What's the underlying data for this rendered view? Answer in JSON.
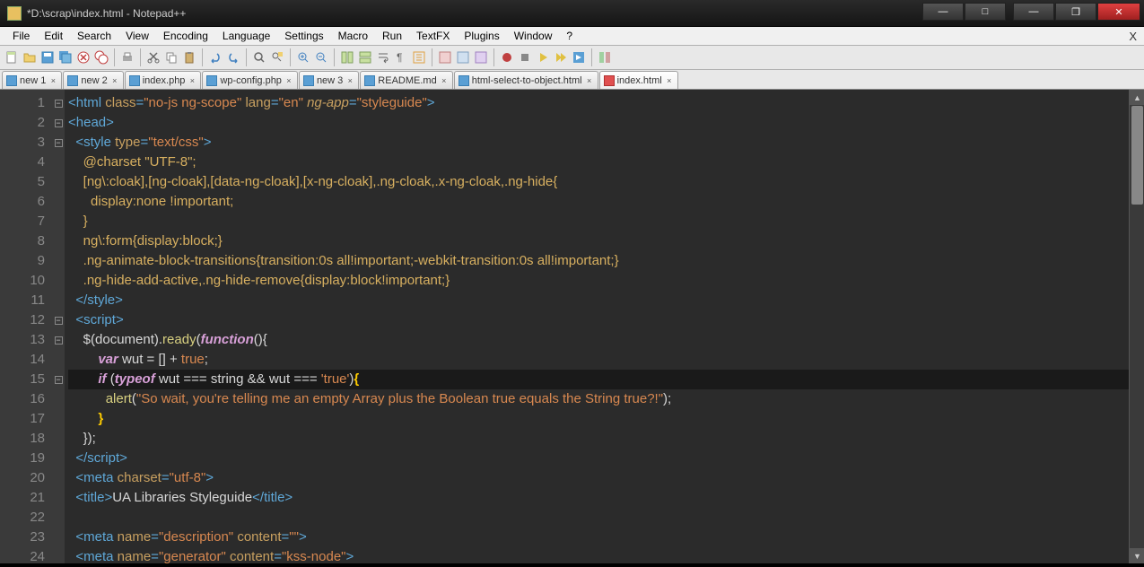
{
  "title": "*D:\\scrap\\index.html - Notepad++",
  "menu": [
    "File",
    "Edit",
    "Search",
    "View",
    "Encoding",
    "Language",
    "Settings",
    "Macro",
    "Run",
    "TextFX",
    "Plugins",
    "Window",
    "?"
  ],
  "tabs": [
    {
      "label": "new  1",
      "unsaved": false,
      "active": false
    },
    {
      "label": "new  2",
      "unsaved": false,
      "active": false
    },
    {
      "label": "index.php",
      "unsaved": false,
      "active": false
    },
    {
      "label": "wp-config.php",
      "unsaved": false,
      "active": false
    },
    {
      "label": "new  3",
      "unsaved": false,
      "active": false
    },
    {
      "label": "README.md",
      "unsaved": false,
      "active": false
    },
    {
      "label": "html-select-to-object.html",
      "unsaved": false,
      "active": false
    },
    {
      "label": "index.html",
      "unsaved": true,
      "active": true
    }
  ],
  "lines_start": 1,
  "lines_end": 24,
  "highlighted_line": 15,
  "fold_markers": {
    "1": "-",
    "2": "-",
    "3": "-",
    "12": "-",
    "13": "-",
    "15": "-"
  },
  "code": {
    "l1": {
      "pre": "<",
      "tag": "html",
      "sp": " ",
      "a1": "class",
      "eq1": "=",
      "v1": "\"no-js ng-scope\"",
      "sp2": " ",
      "a2": "lang",
      "eq2": "=",
      "v2": "\"en\"",
      "sp3": " ",
      "a3": "ng-app",
      "eq3": "=",
      "v3": "\"styleguide\"",
      "post": ">"
    },
    "l2": {
      "pre": "<",
      "tag": "head",
      "post": ">"
    },
    "l3": {
      "indent": "  ",
      "pre": "<",
      "tag": "style",
      "sp": " ",
      "a1": "type",
      "eq": "=",
      "v1": "\"text/css\"",
      "post": ">"
    },
    "l4": {
      "indent": "    ",
      "text": "@charset \"UTF-8\";"
    },
    "l5": {
      "indent": "    ",
      "text": "[ng\\:cloak],[ng-cloak],[data-ng-cloak],[x-ng-cloak],.ng-cloak,.x-ng-cloak,.ng-hide{"
    },
    "l6": {
      "indent": "      ",
      "text": "display:none !important;"
    },
    "l7": {
      "indent": "    ",
      "text": "}"
    },
    "l8": {
      "indent": "    ",
      "text": "ng\\:form{display:block;}"
    },
    "l9": {
      "indent": "    ",
      "text": ".ng-animate-block-transitions{transition:0s all!important;-webkit-transition:0s all!important;}"
    },
    "l10": {
      "indent": "    ",
      "text": ".ng-hide-add-active,.ng-hide-remove{display:block!important;}"
    },
    "l11": {
      "indent": "  ",
      "pre": "</",
      "tag": "style",
      "post": ">"
    },
    "l12": {
      "indent": "  ",
      "pre": "<",
      "tag": "script",
      "post": ">"
    },
    "l13": {
      "indent": "    ",
      "jq": "$(document).",
      "ready": "ready",
      "p1": "(",
      "fn": "function",
      "p2": "(){"
    },
    "l14": {
      "indent": "        ",
      "kw": "var",
      "sp": " ",
      "name": "wut = [] + ",
      "bool": "true",
      "semi": ";"
    },
    "l15": {
      "indent": "        ",
      "if": "if ",
      "p1": "(",
      "to": "typeof",
      "sp": " ",
      "rest1": "wut === string && wut === ",
      "str": "'true'",
      "p2": ")",
      "brace": "{"
    },
    "l16": {
      "indent": "          ",
      "fn": "alert",
      "p1": "(",
      "str": "\"So wait, you're telling me an empty Array plus the Boolean true equals the String true?!\"",
      "p2": ");"
    },
    "l17": {
      "indent": "        ",
      "text": "}"
    },
    "l18": {
      "indent": "    ",
      "text": "});"
    },
    "l19": {
      "indent": "  ",
      "pre": "</",
      "tag": "script",
      "post": ">"
    },
    "l20": {
      "indent": "  ",
      "pre": "<",
      "tag": "meta",
      "sp": " ",
      "a1": "charset",
      "eq": "=",
      "v1": "\"utf-8\"",
      "post": ">"
    },
    "l21": {
      "indent": "  ",
      "pre": "<",
      "tag": "title",
      "post": ">",
      "text": "UA Libraries Styleguide",
      "pre2": "</",
      "tag2": "title",
      "post2": ">"
    },
    "l22": {
      "indent": ""
    },
    "l23": {
      "indent": "  ",
      "pre": "<",
      "tag": "meta",
      "sp": " ",
      "a1": "name",
      "eq1": "=",
      "v1": "\"description\"",
      "sp2": " ",
      "a2": "content",
      "eq2": "=",
      "v2": "\"\"",
      "post": ">"
    },
    "l24": {
      "indent": "  ",
      "pre": "<",
      "tag": "meta",
      "sp": " ",
      "a1": "name",
      "eq1": "=",
      "v1": "\"generator\"",
      "sp2": " ",
      "a2": "content",
      "eq2": "=",
      "v2": "\"kss-node\"",
      "post": ">"
    }
  }
}
